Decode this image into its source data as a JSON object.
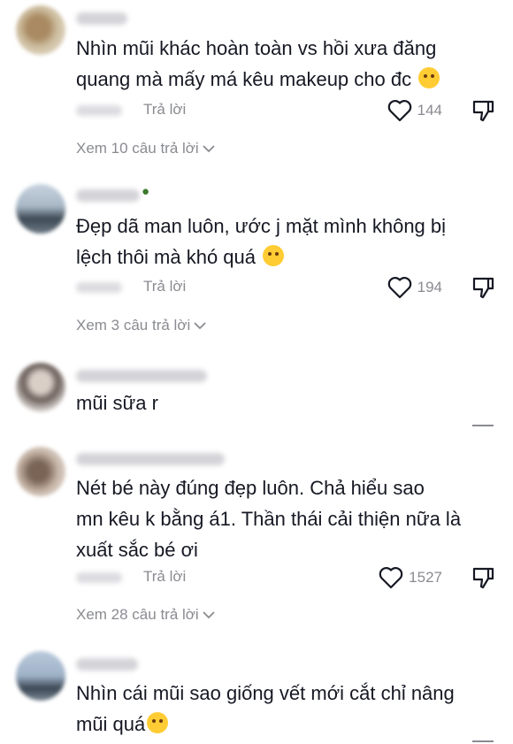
{
  "comments": [
    {
      "text_lines": [
        "Nhìn mũi khác hoàn toàn vs hồi xưa đăng",
        "quang mà mấy má kêu makeup cho đc"
      ],
      "emoji": "laughing-emoji",
      "reply_label": "Trả lời",
      "likes": "144",
      "view_replies": "Xem 10 câu trả lời"
    },
    {
      "text_lines": [
        "Đẹp dã man luôn, ước j mặt mình không bị",
        "lệch thôi mà khó quá"
      ],
      "emoji": "pleading-emoji",
      "reply_label": "Trả lời",
      "likes": "194",
      "view_replies": "Xem 3 câu trả lời"
    },
    {
      "text_lines": [
        "mũi sữa r"
      ]
    },
    {
      "text_lines": [
        "Nét bé này đúng đẹp luôn. Chả hiểu sao",
        "mn kêu k bằng á1. Thần thái cải thiện nữa là",
        "xuất sắc bé ơi"
      ],
      "reply_label": "Trả lời",
      "likes": "1527",
      "view_replies": "Xem 28 câu trả lời"
    },
    {
      "text_lines": [
        "Nhìn cái mũi sao giống vết mới cắt chỉ nâng",
        "mũi quá"
      ],
      "emoji": "tears-of-joy-emoji"
    }
  ],
  "colors": {
    "text": "#161823",
    "secondary": "#8a8b91",
    "emoji_yellow": "#ffcc33"
  }
}
